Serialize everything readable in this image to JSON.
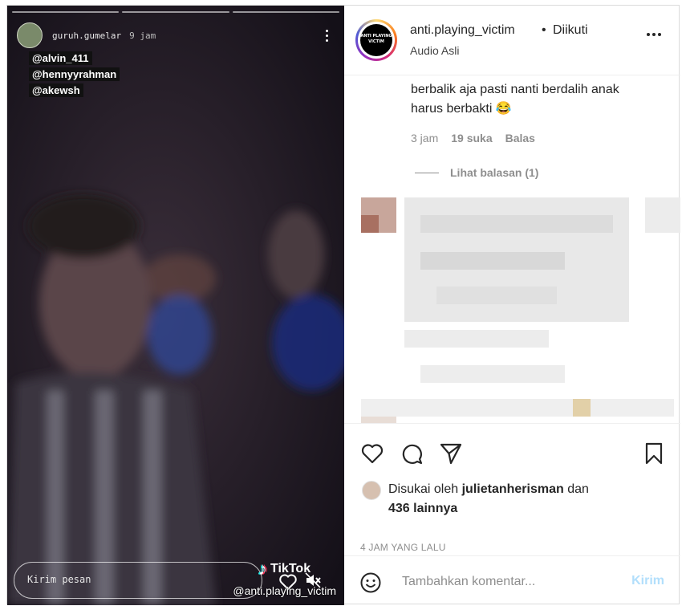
{
  "story": {
    "username": "guruh.gumelar",
    "time": "9 jam",
    "mentions": [
      "@alvin_411",
      "@hennyyrahman",
      "@akewsh"
    ],
    "message_placeholder": "Kirim pesan",
    "tiktok_label": "TikTok",
    "handle": "@anti.playing_victim",
    "progress_segments": 3
  },
  "post": {
    "username": "anti.playing_victim",
    "separator": "•",
    "follow_status": "Diikuti",
    "audio": "Audio Asli",
    "avatar_text": "ANTI PLAYING VICTIM",
    "more_icon": "more-horizontal-icon"
  },
  "comment": {
    "text": "berbalik aja pasti nanti berdalih anak harus berbakti 😂",
    "time": "3 jam",
    "likes": "19 suka",
    "reply": "Balas",
    "view_replies": "Lihat balasan (1)"
  },
  "actions": {
    "icons": [
      "heart-icon",
      "comment-icon",
      "share-icon",
      "bookmark-icon"
    ],
    "liked_prefix": "Disukai oleh",
    "liked_user": "julietanherisman",
    "liked_middle": "dan",
    "liked_others": "436 lainnya",
    "time_ago": "4 JAM YANG LALU"
  },
  "add_comment": {
    "placeholder": "Tambahkan komentar...",
    "post_label": "Kirim"
  },
  "colors": {
    "post_button": "#b2dffc",
    "muted_text": "#8e8e8e",
    "text": "#262626"
  }
}
